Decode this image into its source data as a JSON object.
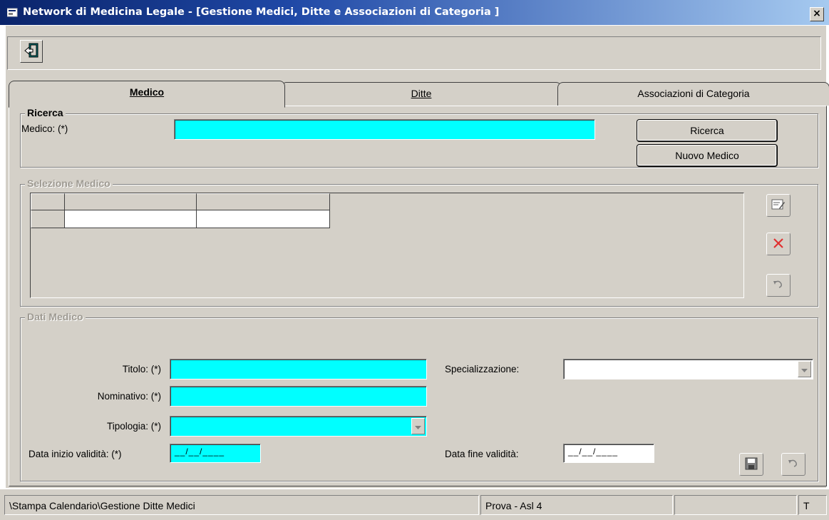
{
  "window": {
    "title": "Network di Medicina Legale - [Gestione Medici, Ditte e Associazioni di Categoria ]",
    "close_label": "×"
  },
  "toolbar": {
    "exit_icon": "exit-door-icon"
  },
  "tabs": [
    {
      "label": "Medico",
      "active": true
    },
    {
      "label": "Ditte",
      "active": false
    },
    {
      "label": "Associazioni di Categoria",
      "active": false
    }
  ],
  "ricerca": {
    "legend": "Ricerca",
    "medico_label": "Medico: (*)",
    "medico_value": "",
    "search_button": "Ricerca",
    "new_button": "Nuovo Medico"
  },
  "selezione": {
    "legend": "Selezione Medico",
    "grid_rows": [
      [
        "",
        "",
        ""
      ]
    ],
    "buttons": [
      "edit-icon",
      "delete-icon",
      "undo-icon"
    ]
  },
  "dati": {
    "legend": "Dati Medico",
    "titolo_label": "Titolo: (*)",
    "titolo_value": "",
    "nominativo_label": "Nominativo: (*)",
    "nominativo_value": "",
    "tipologia_label": "Tipologia: (*)",
    "tipologia_value": "",
    "data_inizio_label": "Data inizio validità: (*)",
    "data_inizio_value": "__/__/____",
    "specializzazione_label": "Specializzazione:",
    "specializzazione_value": "",
    "data_fine_label": "Data fine validità:",
    "data_fine_value": "__/__/____",
    "buttons": [
      "save-icon",
      "undo-icon"
    ]
  },
  "statusbar": {
    "path": "\\Stampa Calendario\\Gestione Ditte Medici",
    "env": "Prova - Asl 4",
    "empty": "",
    "mode": "T"
  },
  "colors": {
    "titlebar_start": "#0a246a",
    "titlebar_end": "#a6caf0",
    "required_field": "#00ffff",
    "face": "#d4d0c8",
    "delete_red": "#e03030"
  }
}
